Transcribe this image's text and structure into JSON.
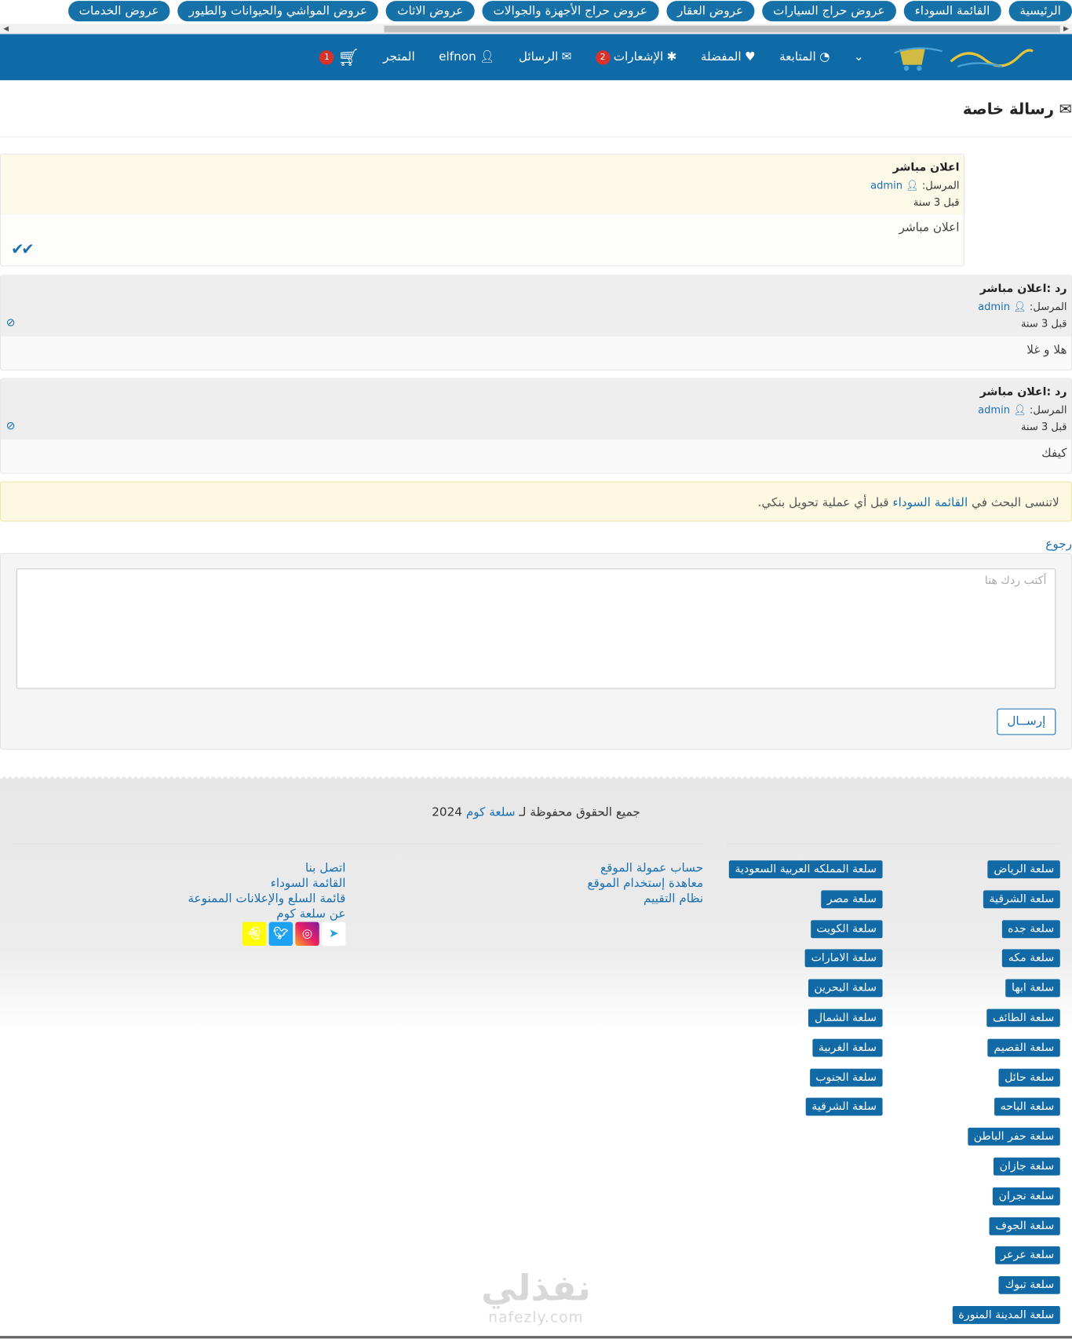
{
  "top_tabs": [
    "الرئيسية",
    "القائمة السوداء",
    "عروض حراج السيارات",
    "عروض العقار",
    "عروض حراج الأجهزة والجوالات",
    "عروض الاثاث",
    "عروض المواشي والحيوانات والطيور",
    "عروض الخدمات"
  ],
  "nav": {
    "cart_count": "1",
    "store": "المتجر",
    "user": "elfnon",
    "messages": "الرسائل",
    "notifications": "الإشعارات",
    "notifications_count": "2",
    "favorites": "المفضلة",
    "following": "المتابعة"
  },
  "page_title": "رسالة خاصة",
  "messages": [
    {
      "subject": "اعلان مباشر",
      "sender_label": "المرسل:",
      "sender": "admin",
      "time": "قبل 3 سنة",
      "body": "اعلان مباشر"
    },
    {
      "subject": "رد :اعلان مباشر",
      "sender_label": "المرسل:",
      "sender": "admin",
      "time": "قبل 3 سنة",
      "body": "هلا و غلا"
    },
    {
      "subject": "رد :اعلان مباشر",
      "sender_label": "المرسل:",
      "sender": "admin",
      "time": "قبل 3 سنة",
      "body": "كيفك"
    }
  ],
  "notice": {
    "before": "لاتنسى البحث في ",
    "link": "القائمة السوداء",
    "after": " قبل أي عملية تحويل بنكي."
  },
  "back_link": "رجوع",
  "reply": {
    "placeholder": "أكتب ردك هنا",
    "send_label": "إرســال"
  },
  "footer": {
    "copyright_before": "جميع الحقوق محفوظة لـ ",
    "copyright_link": "سلعة كوم",
    "copyright_year": " 2024",
    "links_col1": [
      "اتصل بنا",
      "القائمة السوداء",
      "قائمة السلع والإعلانات الممنوعة",
      "عن سلعة كوم"
    ],
    "links_col2": [
      "حساب عمولة الموقع",
      "معاهدة إستخدام الموقع",
      "نظام التقييم"
    ],
    "tags_col_a": [
      "سلعة الرياض",
      "سلعة الشرقية",
      "سلعة جده",
      "سلعة مكه",
      "سلعة ابها",
      "سلعة الطائف",
      "سلعة القصيم",
      "سلعة حائل",
      "سلعة الباحه",
      "سلعة حفر الباطن",
      "سلعة جازان",
      "سلعة نجران",
      "سلعة الجوف",
      "سلعة عرعر",
      "سلعة تبوك",
      "سلعة المدينة المنورة"
    ],
    "tags_col_b": [
      "سلعة المملكه العربية السعودية",
      "سلعة مصر",
      "سلعة الكويت",
      "سلعة الامارات",
      "سلعة البحرين",
      "سلعة الشمال",
      "سلعة الغربية",
      "سلعة الجنوب",
      "سلعة الشرقية"
    ]
  },
  "watermark": {
    "ar": "نفذلي",
    "en": "nafezly.com"
  }
}
